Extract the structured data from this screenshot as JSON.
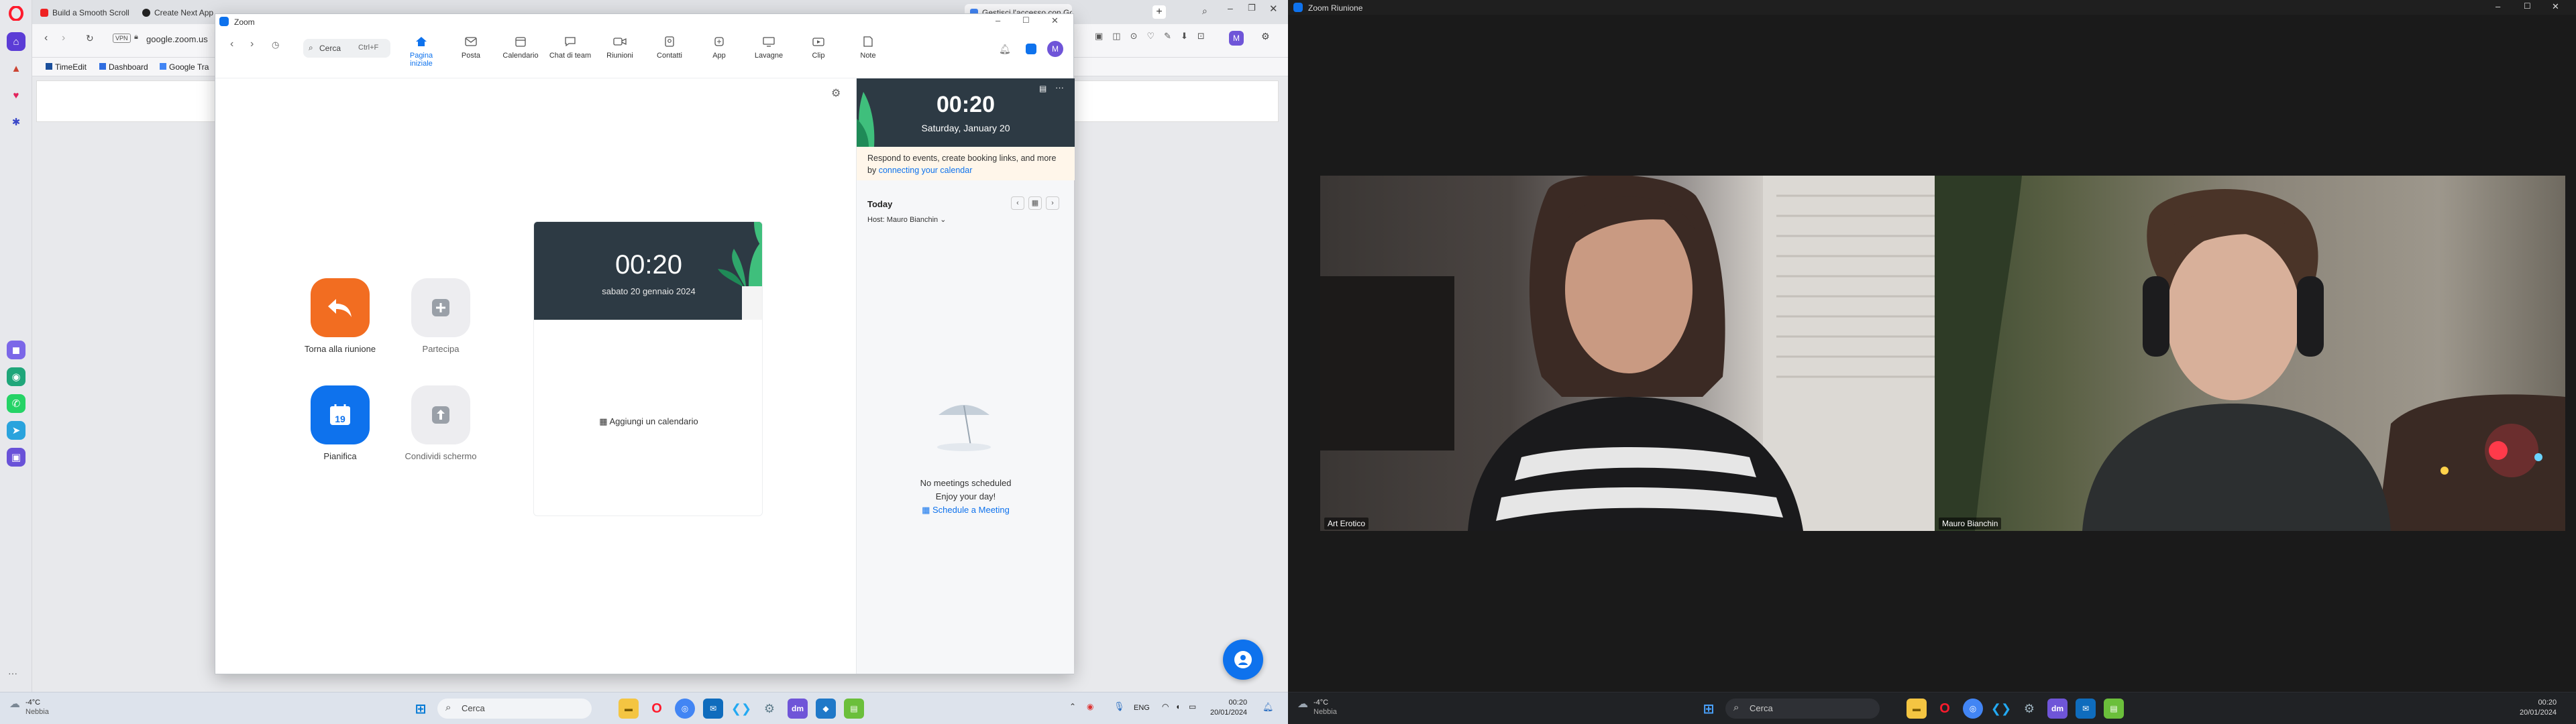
{
  "opera": {
    "tabs": [
      "Build a Smooth Scroll",
      "Create Next App",
      "",
      "",
      "",
      "",
      "",
      "",
      "",
      "Gestisci l'accesso con Go"
    ],
    "address": "google.zoom.us",
    "vpn_label": "VPN",
    "bookmarks": [
      "TimeEdit",
      "Dashboard",
      "Google Tra"
    ],
    "profile_initial": "M",
    "more_dots": "···"
  },
  "zoom": {
    "window_title": "Zoom",
    "search_placeholder": "Cerca",
    "search_shortcut": "Ctrl+F",
    "nav": [
      {
        "label": "Pagina iniziale",
        "icon": "home-icon"
      },
      {
        "label": "Posta",
        "icon": "mail-icon"
      },
      {
        "label": "Calendario",
        "icon": "calendar-icon"
      },
      {
        "label": "Chat di team",
        "icon": "chat-icon"
      },
      {
        "label": "Riunioni",
        "icon": "video-icon"
      },
      {
        "label": "Contatti",
        "icon": "contacts-icon"
      },
      {
        "label": "App",
        "icon": "apps-icon"
      },
      {
        "label": "Lavagne",
        "icon": "whiteboard-icon"
      },
      {
        "label": "Clip",
        "icon": "clip-icon"
      },
      {
        "label": "Note",
        "icon": "note-icon"
      }
    ],
    "avatar_initial": "M",
    "actions": [
      {
        "label": "Torna alla riunione",
        "color": "#f26d21"
      },
      {
        "label": "Partecipa",
        "color": "#ededf0"
      },
      {
        "label": "Pianifica",
        "color": "#0e72ed"
      },
      {
        "label": "Condividi schermo",
        "color": "#ededf0"
      }
    ],
    "schedule_day": "19",
    "main_clock": {
      "time": "00:20",
      "date": "sabato 20 gennaio 2024"
    },
    "add_calendar": "Aggiungi un calendario",
    "side_clock": {
      "time": "00:20",
      "date": "Saturday, January 20"
    },
    "notice_text": "Respond to events, create booking links, and more by ",
    "notice_link": "connecting your calendar",
    "today_label": "Today",
    "host_label": "Host: Mauro Bianchin",
    "no_meetings": "No meetings scheduled",
    "enjoy": "Enjoy your day!",
    "schedule_link": "Schedule a Meeting",
    "accent": "#0e72ed"
  },
  "taskbar_left": {
    "weather_temp": "-4°C",
    "weather_desc": "Nebbia",
    "search": "Cerca",
    "lang": "ENG",
    "time": "00:20",
    "date": "20/01/2024"
  },
  "meeting": {
    "window_title": "Zoom Riunione",
    "participants": [
      "Art Erotico",
      "Mauro Bianchin"
    ]
  },
  "taskbar_right": {
    "weather_temp": "-4°C",
    "weather_desc": "Nebbia",
    "search": "Cerca",
    "time": "00:20",
    "date": "20/01/2024"
  }
}
